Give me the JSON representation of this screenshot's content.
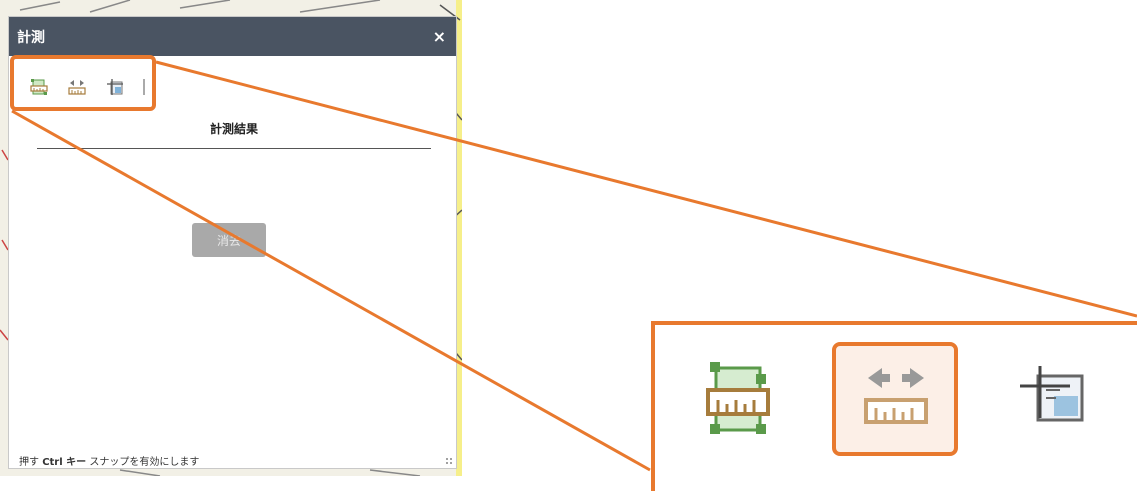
{
  "widget": {
    "title": "計測",
    "close_label": "×",
    "tools": [
      {
        "name": "area-measure",
        "icon": "area-measure-icon"
      },
      {
        "name": "distance-measure",
        "icon": "distance-measure-icon"
      },
      {
        "name": "location-measure",
        "icon": "location-measure-icon"
      }
    ],
    "result_heading": "計測結果",
    "clear_button": "消去",
    "hint_prefix": "押す",
    "hint_key": "Ctrl キー",
    "hint_suffix": "スナップを有効にします"
  },
  "colors": {
    "header_bg": "#4a5462",
    "highlight": "#e8792e",
    "map_bg": "#f3f1e8"
  }
}
